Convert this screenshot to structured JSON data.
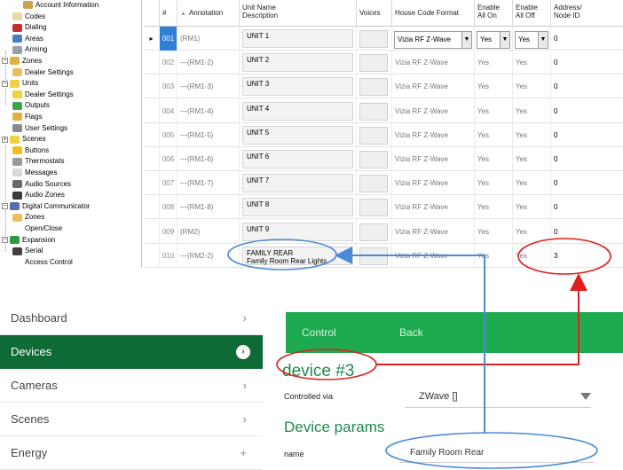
{
  "tree": {
    "items": [
      {
        "label": "Account Information",
        "icon": "account-icon"
      },
      {
        "label": "Codes",
        "icon": "codes-icon"
      },
      {
        "label": "Dialing",
        "icon": "phone-icon"
      },
      {
        "label": "Areas",
        "icon": "areas-icon"
      },
      {
        "label": "Arming",
        "icon": "arming-icon"
      },
      {
        "label": "Zones",
        "icon": "zones-icon"
      },
      {
        "label": "Dealer Settings",
        "icon": "folder-icon"
      },
      {
        "label": "Units",
        "icon": "bulb-icon"
      },
      {
        "label": "Dealer Settings",
        "icon": "bulb-icon"
      },
      {
        "label": "Outputs",
        "icon": "arrow-icon"
      },
      {
        "label": "Flags",
        "icon": "flag-icon"
      },
      {
        "label": "User Settings",
        "icon": "wrench-icon"
      },
      {
        "label": "Scenes",
        "icon": "bulb-icon"
      },
      {
        "label": "Buttons",
        "icon": "star-icon"
      },
      {
        "label": "Thermostats",
        "icon": "thermostat-icon"
      },
      {
        "label": "Messages",
        "icon": "message-icon"
      },
      {
        "label": "Audio Sources",
        "icon": "audio-icon"
      },
      {
        "label": "Audio Zones",
        "icon": "speaker-icon"
      },
      {
        "label": "Digital Communicator",
        "icon": "comm-icon"
      },
      {
        "label": "Zones",
        "icon": "folder-icon"
      },
      {
        "label": "Open/Close",
        "icon": "blank-icon"
      },
      {
        "label": "Expansion",
        "icon": "expansion-icon"
      },
      {
        "label": "Serial",
        "icon": "serial-icon"
      },
      {
        "label": "Access Control",
        "icon": "blank-icon"
      }
    ]
  },
  "grid": {
    "headers": {
      "num": "#",
      "sort_glyph": "▲",
      "annotation": "Annotation",
      "unit_name": "Unit Name",
      "description": "Description",
      "voices": "Voices",
      "house_code": "House Code Format",
      "enable_on_1": "Enable",
      "enable_on_2": "All On",
      "enable_off_1": "Enable",
      "enable_off_2": "All Off",
      "address_1": "Address/",
      "address_2": "Node ID"
    },
    "rows": [
      {
        "num": "001",
        "annotation": "(RM1)",
        "unit": "UNIT 1",
        "desc": "",
        "format": "Vizia RF Z-Wave",
        "on": "Yes",
        "off": "Yes",
        "addr": "0"
      },
      {
        "num": "002",
        "annotation": "—(RM1-2)",
        "unit": "UNIT 2",
        "desc": "",
        "format": "Vizia RF Z-Wave",
        "on": "Yes",
        "off": "Yes",
        "addr": "0"
      },
      {
        "num": "003",
        "annotation": "—(RM1-3)",
        "unit": "UNIT 3",
        "desc": "",
        "format": "Vizia RF Z-Wave",
        "on": "Yes",
        "off": "Yes",
        "addr": "0"
      },
      {
        "num": "004",
        "annotation": "—(RM1-4)",
        "unit": "UNIT 4",
        "desc": "",
        "format": "Vizia RF Z-Wave",
        "on": "Yes",
        "off": "Yes",
        "addr": "0"
      },
      {
        "num": "005",
        "annotation": "—(RM1-5)",
        "unit": "UNIT 5",
        "desc": "",
        "format": "Vizia RF Z-Wave",
        "on": "Yes",
        "off": "Yes",
        "addr": "0"
      },
      {
        "num": "006",
        "annotation": "—(RM1-6)",
        "unit": "UNIT 6",
        "desc": "",
        "format": "Vizia RF Z-Wave",
        "on": "Yes",
        "off": "Yes",
        "addr": "0"
      },
      {
        "num": "007",
        "annotation": "—(RM1-7)",
        "unit": "UNIT 7",
        "desc": "",
        "format": "Vizia RF Z-Wave",
        "on": "Yes",
        "off": "Yes",
        "addr": "0"
      },
      {
        "num": "008",
        "annotation": "—(RM1-8)",
        "unit": "UNIT 8",
        "desc": "",
        "format": "Vizia RF Z-Wave",
        "on": "Yes",
        "off": "Yes",
        "addr": "0"
      },
      {
        "num": "009",
        "annotation": "(RM2)",
        "unit": "UNIT 9",
        "desc": "",
        "format": "Vizia RF Z-Wave",
        "on": "Yes",
        "off": "Yes",
        "addr": "0"
      },
      {
        "num": "010",
        "annotation": "—(RM2-2)",
        "unit": "FAMILY REAR",
        "desc": "Family Room Rear Lights",
        "format": "Vizia RF Z-Wave",
        "on": "Yes",
        "off": "Yes",
        "addr": "3"
      }
    ]
  },
  "sidebar": {
    "items": [
      {
        "label": "Dashboard",
        "glyph": "›"
      },
      {
        "label": "Devices",
        "glyph": "›"
      },
      {
        "label": "Cameras",
        "glyph": "›"
      },
      {
        "label": "Scenes",
        "glyph": "›"
      },
      {
        "label": "Energy",
        "glyph": "+"
      }
    ]
  },
  "device": {
    "nav_control": "Control",
    "nav_back": "Back",
    "title": "device #3",
    "controlled_label": "Controlled via",
    "controlled_value": "ZWave []",
    "params_title": "Device params",
    "name_label": "name",
    "name_value": "Family Room Rear"
  },
  "colors": {
    "accent_green": "#1eaa4f",
    "sidebar_active": "#0e6b36",
    "highlight_red": "#e0201b",
    "highlight_blue": "#4a8ad8",
    "selected_row": "#2f7ed8"
  }
}
